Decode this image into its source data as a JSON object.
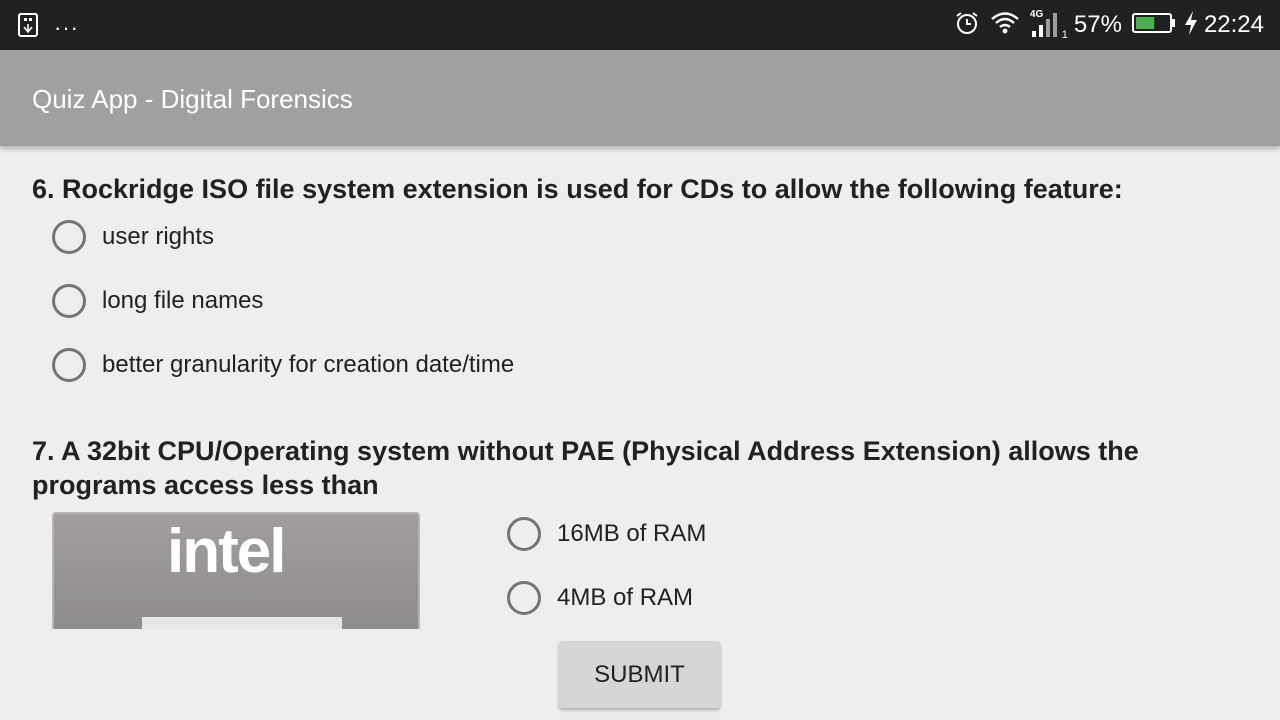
{
  "status_bar": {
    "battery_percent": "57%",
    "time": "22:24",
    "network_label": "4G",
    "sim_index": "1",
    "left_dots": "···",
    "battery_level": 0.57,
    "icons": [
      "usb-icon",
      "alarm-icon",
      "wifi-icon",
      "cellular-signal-icon",
      "battery-icon",
      "charging-bolt-icon"
    ]
  },
  "app_bar": {
    "title": "Quiz App - Digital Forensics"
  },
  "questions": [
    {
      "text": "6. Rockridge ISO file system extension is used for CDs to allow the following feature:",
      "options": [
        "user rights",
        "long file names",
        "better granularity for creation date/time"
      ]
    },
    {
      "text": "7. A 32bit CPU/Operating system without PAE (Physical Address Extension) allows the programs access less than",
      "image_logo_text": "intel",
      "options": [
        "16MB of RAM",
        "4MB of RAM"
      ]
    }
  ],
  "submit": {
    "label": "SUBMIT"
  }
}
